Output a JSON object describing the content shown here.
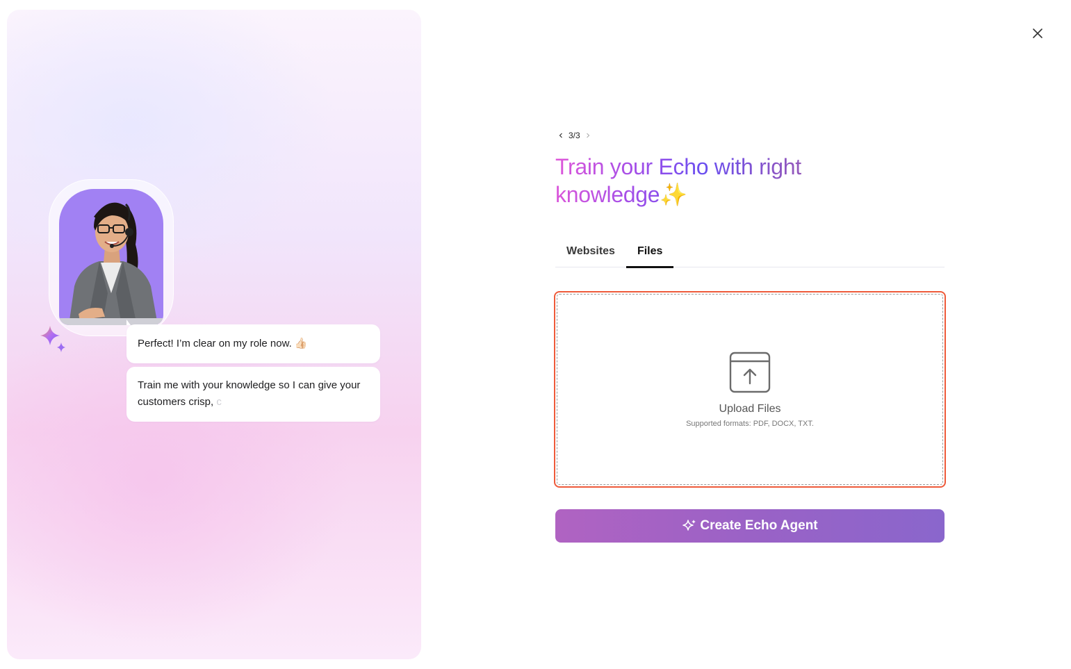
{
  "onboarding": {
    "chat": {
      "message_1": "Perfect! I’m clear on my role now. 👍🏻",
      "message_2_text": "Train me with your knowledge so I can give your customers crisp, ",
      "message_2_typing_char": "c"
    }
  },
  "stepper": {
    "current": "3/3"
  },
  "header": {
    "title": "Train your Echo with right knowledge",
    "title_sparkle": "✨"
  },
  "tabs": [
    {
      "label": "Websites",
      "active": false
    },
    {
      "label": "Files",
      "active": true
    }
  ],
  "upload": {
    "title": "Upload Files",
    "subtitle": "Supported formats: PDF, DOCX, TXT."
  },
  "actions": {
    "create_label": "Create Echo Agent"
  },
  "colors": {
    "accent_border": "#ee5a3a",
    "button_start": "#b063c2",
    "button_end": "#8a66cc",
    "avatar_bg": "#a181f3"
  },
  "icons": {
    "close": "close-icon",
    "prev": "chevron-left-icon",
    "next": "chevron-right-icon",
    "upload": "upload-box-icon",
    "sparkle": "sparkle-icon"
  }
}
